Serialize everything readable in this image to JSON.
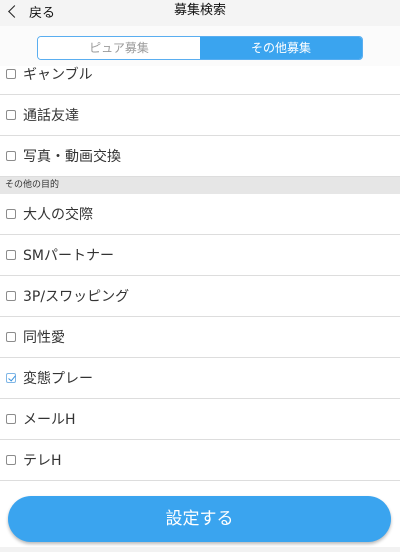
{
  "nav": {
    "back_label": "戻る",
    "title": "募集検索"
  },
  "segments": {
    "pure": "ピュア募集",
    "other": "その他募集",
    "selected": "other"
  },
  "list": {
    "items_before": [
      {
        "label": "ギャンブル",
        "checked": false
      },
      {
        "label": "通話友達",
        "checked": false
      },
      {
        "label": "写真・動画交換",
        "checked": false
      }
    ],
    "section_title": "その他の目的",
    "items_after": [
      {
        "label": "大人の交際",
        "checked": false
      },
      {
        "label": "SMパートナー",
        "checked": false
      },
      {
        "label": "3P/スワッピング",
        "checked": false
      },
      {
        "label": "同性愛",
        "checked": false
      },
      {
        "label": "変態プレー",
        "checked": true
      },
      {
        "label": "メールH",
        "checked": false
      },
      {
        "label": "テレH",
        "checked": false
      }
    ]
  },
  "submit_label": "設定する",
  "colors": {
    "accent": "#3aa4ef",
    "section_bg": "#e6e6e6",
    "divider": "#dddddd"
  }
}
